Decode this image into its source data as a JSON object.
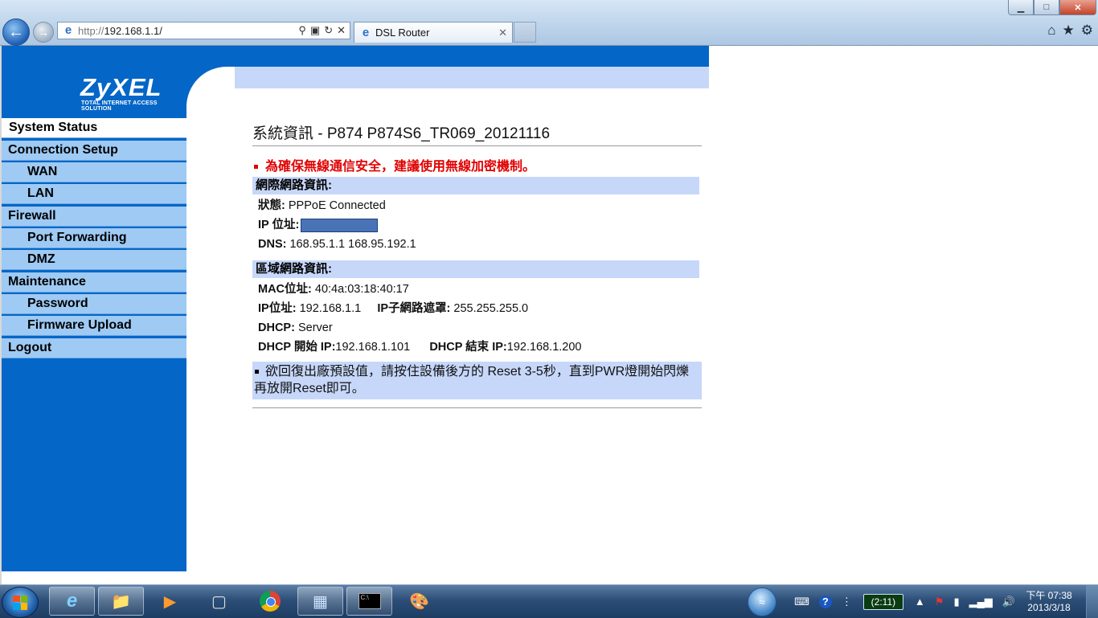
{
  "browser": {
    "address_url_proto": "http://",
    "address_url_host": "192.168.1.1/",
    "tab_title": "DSL Router",
    "window_buttons": {
      "minimize": "▁",
      "maximize": "□",
      "close": "✕"
    },
    "toolbar_icons": [
      "home-icon",
      "star-icon",
      "gear-icon"
    ]
  },
  "sidebar": {
    "logo": "ZyXEL",
    "logo_sub": "TOTAL INTERNET ACCESS SOLUTION",
    "items": [
      {
        "label": "System Status",
        "level": 0,
        "active": true
      },
      {
        "label": "Connection Setup",
        "level": 0
      },
      {
        "label": "WAN",
        "level": 1
      },
      {
        "label": "LAN",
        "level": 1
      },
      {
        "label": "Firewall",
        "level": 0
      },
      {
        "label": "Port Forwarding",
        "level": 1
      },
      {
        "label": "DMZ",
        "level": 1
      },
      {
        "label": "Maintenance",
        "level": 0
      },
      {
        "label": "Password",
        "level": 1
      },
      {
        "label": "Firmware Upload",
        "level": 1
      },
      {
        "label": "Logout",
        "level": 0
      }
    ]
  },
  "main": {
    "title": "系統資訊 - P874   P874S6_TR069_20121116",
    "warning": "為確保無線通信安全，建議使用無線加密機制。",
    "wan_section": "網際網路資訊:",
    "wan": {
      "status_label": "狀態:",
      "status_value": "PPPoE   Connected",
      "ip_label": "IP 位址:",
      "dns_label": "DNS:",
      "dns_value": "168.95.1.1   168.95.192.1"
    },
    "lan_section": "區域網路資訊:",
    "lan": {
      "mac_label": "MAC位址:",
      "mac_value": "40:4a:03:18:40:17",
      "ip_label": "IP位址:",
      "ip_value": "192.168.1.1",
      "mask_label": "IP子網路遮罩:",
      "mask_value": "255.255.255.0",
      "dhcp_label": "DHCP:",
      "dhcp_value": "Server",
      "dhcp_start_label": "DHCP 開始 IP:",
      "dhcp_start_value": "192.168.1.101",
      "dhcp_end_label": "DHCP 結束 IP:",
      "dhcp_end_value": "192.168.1.200"
    },
    "notice": "欲回復出廠預設值，請按住設備後方的 Reset 3-5秒，直到PWR燈開始閃爍再放開Reset即可。"
  },
  "taskbar": {
    "battery": "(2:11)",
    "clock_time": "下午 07:38",
    "clock_date": "2013/3/18"
  }
}
